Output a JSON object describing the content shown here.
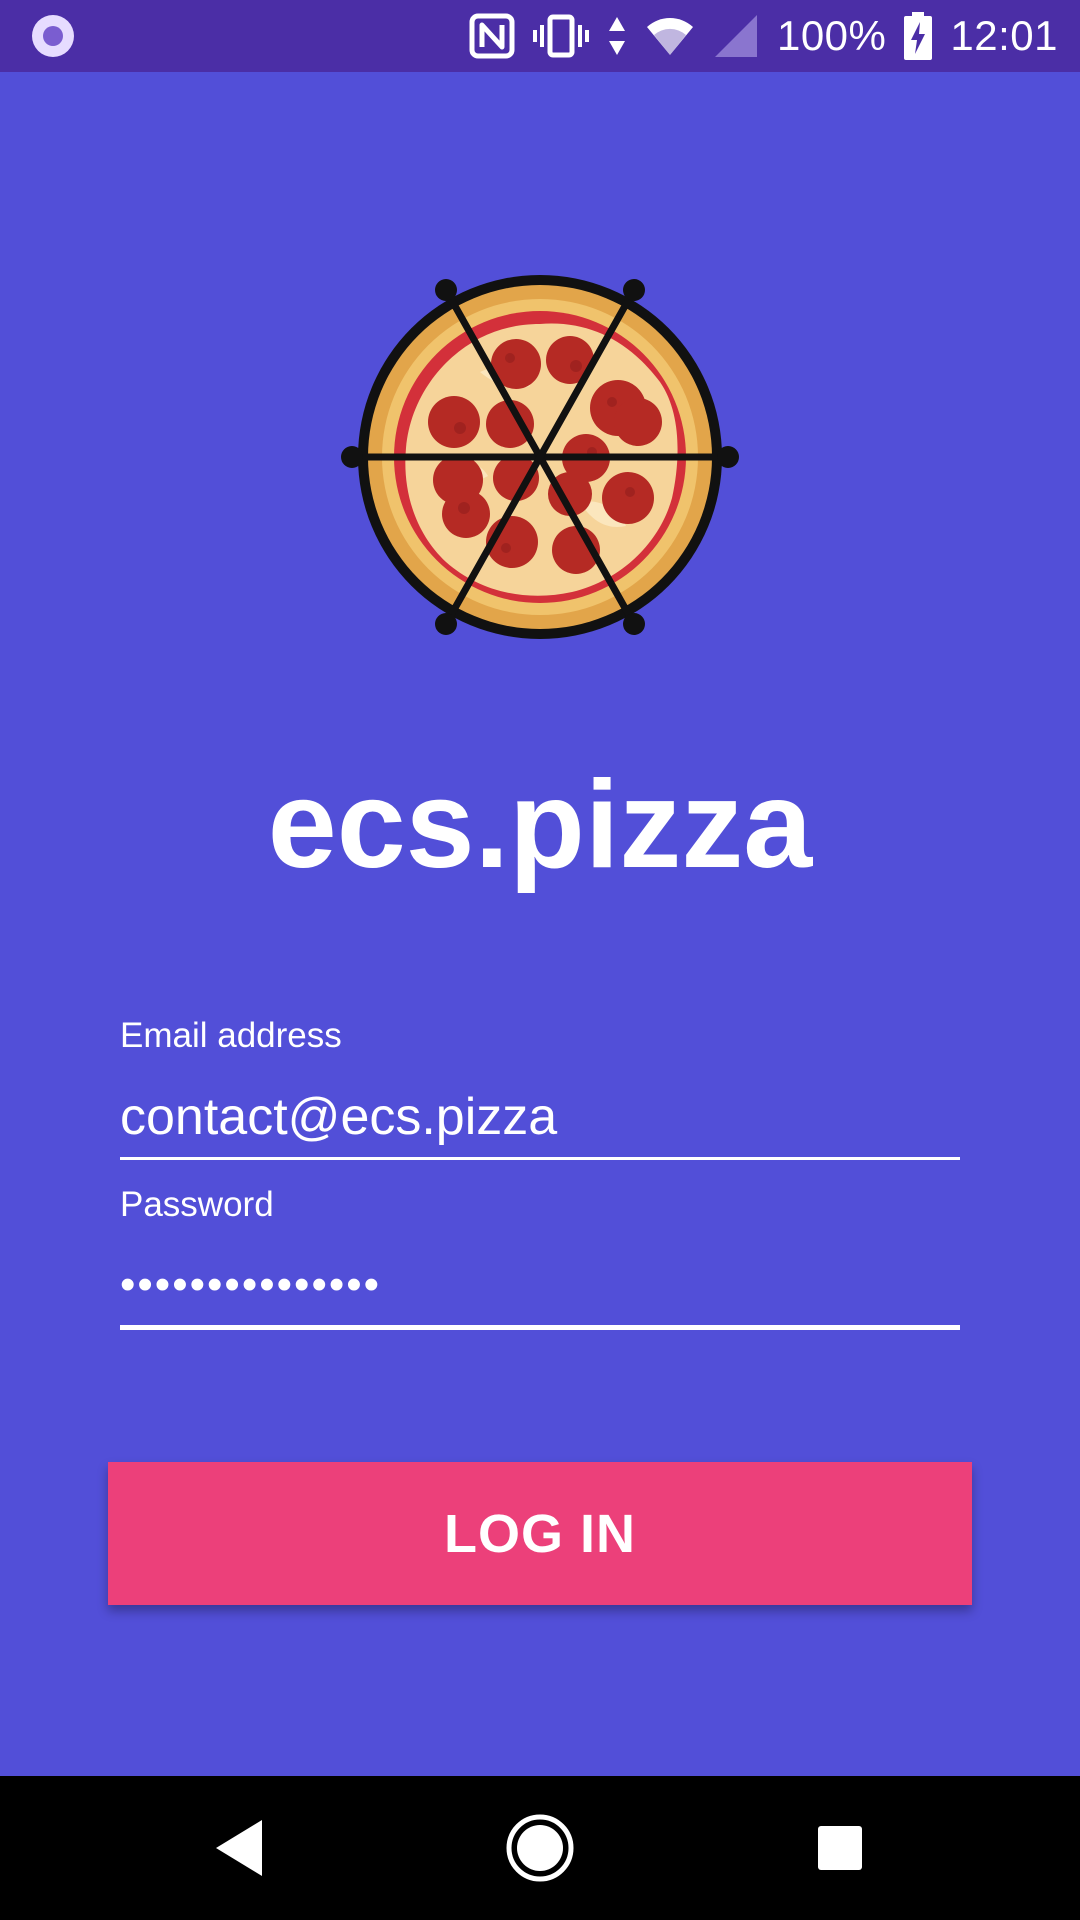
{
  "status_bar": {
    "battery": "100%",
    "time": "12:01",
    "icons": [
      "notification-dot-icon",
      "nfc-icon",
      "vibrate-icon",
      "data-arrows-icon",
      "wifi-icon",
      "signal-icon",
      "battery-charging-icon"
    ]
  },
  "app": {
    "logo": "pizza-logo",
    "title": "ecs.pizza"
  },
  "form": {
    "email_label": "Email address",
    "email_value": "contact@ecs.pizza",
    "password_label": "Password",
    "password_value": "•••••••••••••••",
    "login_label": "LOG IN"
  },
  "nav_bar": {
    "icons": [
      "back-icon",
      "home-icon",
      "recents-icon"
    ]
  },
  "colors": {
    "background": "#524fd8",
    "status_bar": "#4b2ea6",
    "button": "#ec407a",
    "nav_bar": "#000000"
  }
}
